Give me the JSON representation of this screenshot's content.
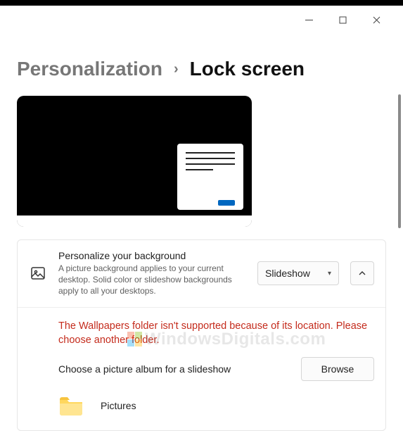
{
  "breadcrumb": {
    "parent": "Personalization",
    "current": "Lock screen"
  },
  "personalize": {
    "title": "Personalize your background",
    "description": "A picture background applies to your current desktop. Solid color or slideshow backgrounds apply to all your desktops.",
    "select_value": "Slideshow"
  },
  "slideshow": {
    "error": "The Wallpapers folder isn't supported because of its location. Please choose another folder.",
    "choose_label": "Choose a picture album for a slideshow",
    "browse_label": "Browse",
    "folder_name": "Pictures"
  },
  "watermark": "WindowsDigitals.com",
  "colors": {
    "error": "#c42b1c",
    "accent": "#0067c0"
  }
}
